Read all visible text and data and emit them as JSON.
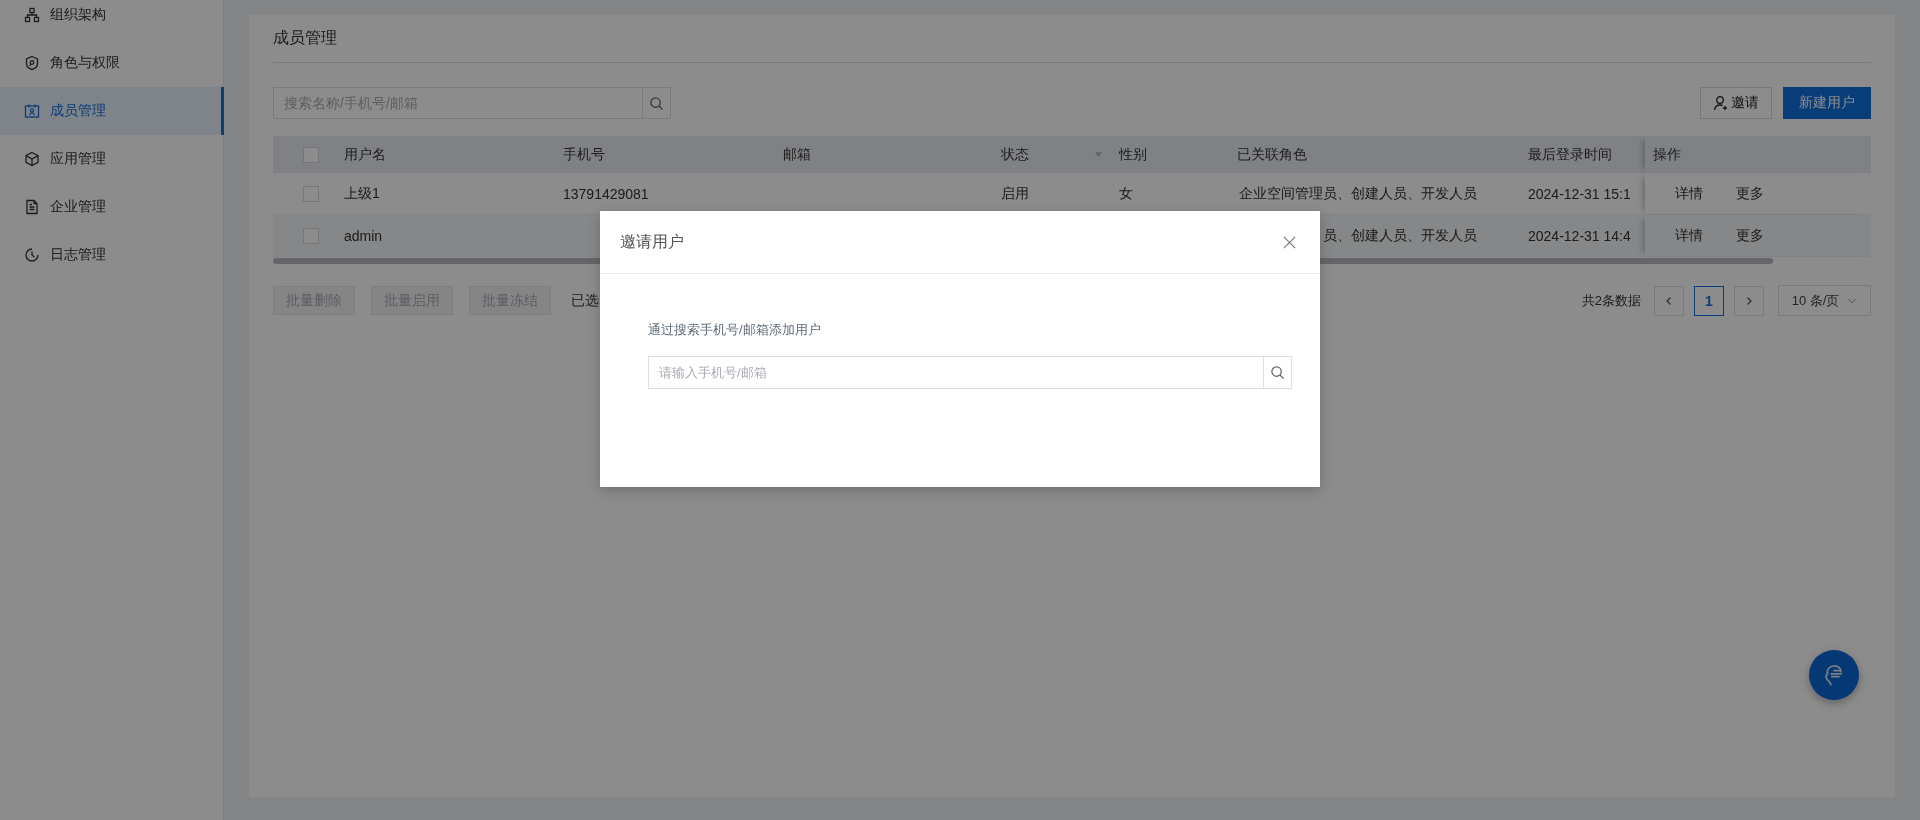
{
  "sidebar": {
    "items": [
      {
        "label": "组织架构",
        "selected": false
      },
      {
        "label": "角色与权限",
        "selected": false
      },
      {
        "label": "成员管理",
        "selected": true
      },
      {
        "label": "应用管理",
        "selected": false
      },
      {
        "label": "企业管理",
        "selected": false
      },
      {
        "label": "日志管理",
        "selected": false
      }
    ]
  },
  "page": {
    "title": "成员管理"
  },
  "toolbar": {
    "search": {
      "placeholder": "搜索名称/手机号/邮箱"
    },
    "buttons": [
      {
        "label": "邀请",
        "kind": "invite"
      },
      {
        "label": "新建用户",
        "kind": "primary"
      }
    ]
  },
  "table": {
    "header_checked": false,
    "columns": [
      "用户名",
      "手机号",
      "邮箱",
      "状态",
      "性别",
      "已关联角色",
      "最后登录时间",
      "操作"
    ],
    "rows": [
      {
        "checked": false,
        "username": "上级1",
        "phone": "13791429081",
        "status": "启用",
        "gender": "女",
        "roles": "企业空间管理员、创建人员、开发人员",
        "last_login": "2024-12-31 15:1",
        "actions": [
          "详情",
          "更多"
        ]
      },
      {
        "checked": false,
        "username": "admin",
        "roles": "员、创建人员、开发人员",
        "last_login": "2024-12-31 14:4",
        "actions": [
          "详情",
          "更多"
        ]
      }
    ]
  },
  "batch_actions": [
    {
      "label": "批量删除",
      "disabled": true
    },
    {
      "label": "批量启用",
      "disabled": true
    },
    {
      "label": "批量冻结",
      "disabled": true
    }
  ],
  "selection_text": "已选",
  "pagination": {
    "total": "共2条数据",
    "pages": [
      {
        "label": "1",
        "selected": true
      }
    ],
    "page_size": "10 条/页"
  },
  "modal": {
    "title": "邀请用户",
    "label": "通过搜索手机号/邮箱添加用户",
    "search": {
      "placeholder": "请输入手机号/邮箱"
    }
  }
}
